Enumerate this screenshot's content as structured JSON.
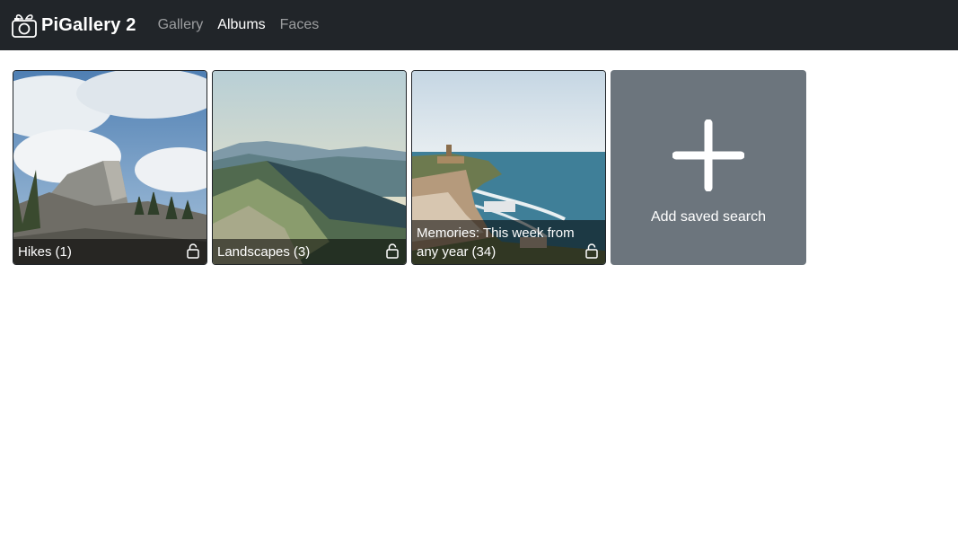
{
  "navbar": {
    "brand": "PiGallery 2",
    "links": [
      {
        "label": "Gallery",
        "active": false
      },
      {
        "label": "Albums",
        "active": true
      },
      {
        "label": "Faces",
        "active": false
      }
    ]
  },
  "albums": [
    {
      "name": "Hikes",
      "count": "(1)",
      "icon": "lock-icon"
    },
    {
      "name": "Landscapes",
      "count": "(3)",
      "icon": "lock-icon"
    },
    {
      "name": "Memories: This week from any year",
      "count": "(34)",
      "icon": "lock-icon"
    }
  ],
  "add_search": {
    "label": "Add saved search",
    "icon": "plus-icon"
  },
  "colors": {
    "navbar_bg": "#212529",
    "add_card_bg": "#6c757d"
  }
}
